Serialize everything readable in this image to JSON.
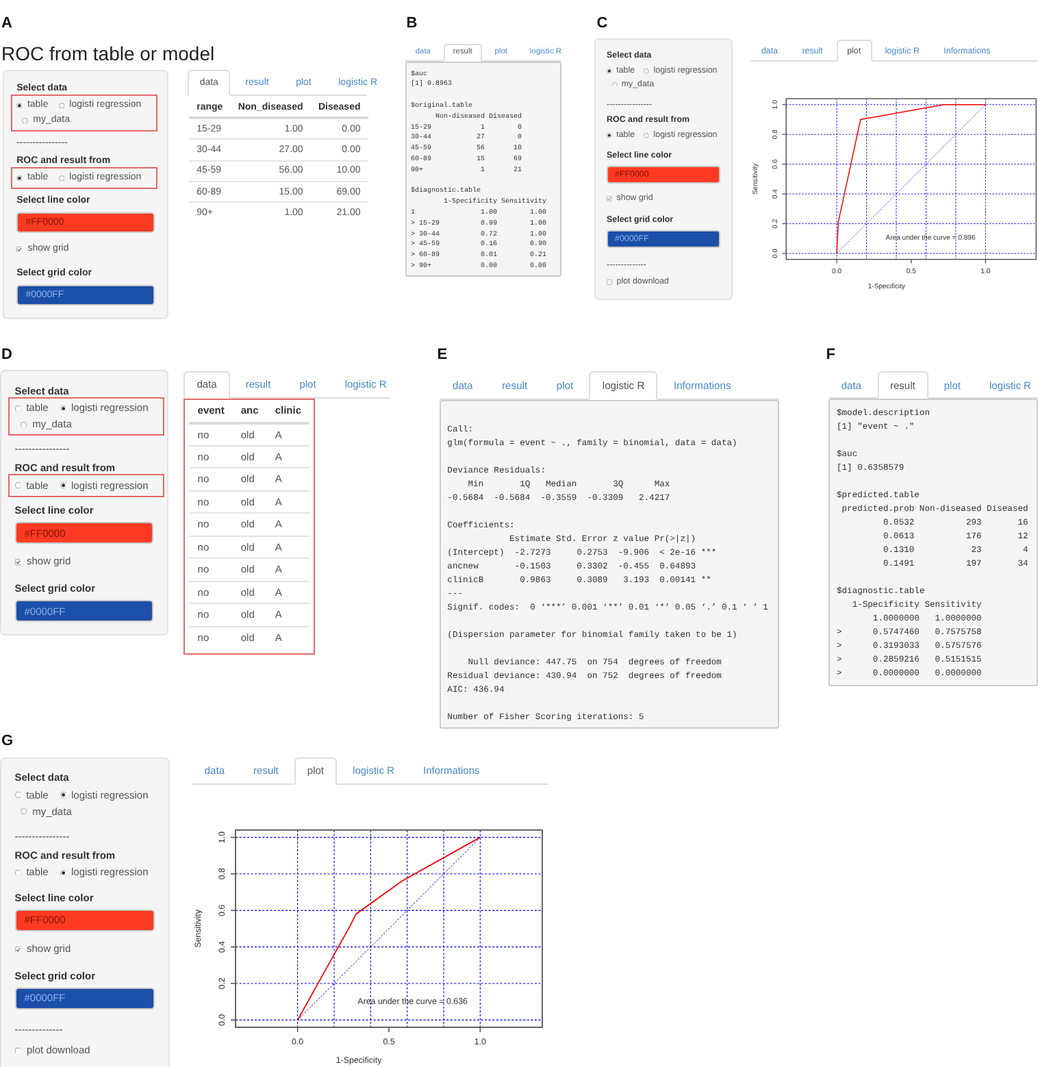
{
  "figure_panels": [
    {
      "letter": "A",
      "title": "ROC from table or model",
      "sidebar": {
        "select_data": {
          "label": "Select data",
          "highlighted": true,
          "options": [
            {
              "label": "table",
              "selected": true
            },
            {
              "label": "logisti regression",
              "selected": false
            },
            {
              "label": "my_data",
              "selected": false
            }
          ]
        },
        "separator": "----------------",
        "roc_source": {
          "label": "ROC and result from",
          "highlighted": true,
          "options": [
            {
              "label": "table",
              "selected": true
            },
            {
              "label": "logisti regression",
              "selected": false
            }
          ]
        },
        "line_color": {
          "label": "Select line color",
          "value": "#FF0000"
        },
        "show_grid": {
          "label": "show grid",
          "checked": true
        },
        "grid_color": {
          "label": "Select grid color",
          "value": "#0000FF"
        }
      },
      "tabs": [
        {
          "label": "data",
          "selected": true
        },
        {
          "label": "result",
          "selected": false
        },
        {
          "label": "plot",
          "selected": false
        },
        {
          "label": "logistic R",
          "selected": false
        }
      ],
      "content": {
        "kind": "table",
        "columns": [
          "range",
          "Non_diseased",
          "Diseased"
        ],
        "rows": [
          [
            "15-29",
            "1.00",
            "0.00"
          ],
          [
            "30-44",
            "27.00",
            "0.00"
          ],
          [
            "45-59",
            "56.00",
            "10.00"
          ],
          [
            "60-89",
            "15.00",
            "69.00"
          ],
          [
            "90+",
            "1.00",
            "21.00"
          ]
        ]
      }
    },
    {
      "letter": "B",
      "tabs": [
        {
          "label": "data",
          "selected": false
        },
        {
          "label": "result",
          "selected": true
        },
        {
          "label": "plot",
          "selected": false
        },
        {
          "label": "logistic R",
          "selected": false
        }
      ],
      "content": {
        "kind": "console",
        "blocks": [
          [
            "$auc",
            "[1] 0.8963"
          ],
          [
            "$original.table",
            "      Non-diseased Diseased",
            "15-29            1        0",
            "30-44           27        0",
            "45-59           56       10",
            "60-89           15       69",
            "90+              1       21"
          ],
          [
            "$diagnostic.table",
            "        1-Specificity Sensitivity",
            "1                1.00        1.00",
            "> 15-29          0.99        1.00",
            "> 30-44          0.72        1.00",
            "> 45-59          0.16        0.90",
            "> 60-89          0.01        0.21",
            "> 90+            0.00        0.00"
          ]
        ]
      }
    },
    {
      "letter": "C",
      "sidebar": {
        "select_data": {
          "label": "Select data",
          "options": [
            {
              "label": "table",
              "selected": true
            },
            {
              "label": "logisti regression",
              "selected": false
            },
            {
              "label": "my_data",
              "selected": false
            }
          ]
        },
        "separator": "----------------",
        "roc_source": {
          "label": "ROC and result from",
          "options": [
            {
              "label": "table",
              "selected": true
            },
            {
              "label": "logisti regression",
              "selected": false
            }
          ]
        },
        "line_color": {
          "label": "Select line color",
          "value": "#FF0000"
        },
        "show_grid": {
          "label": "show grid",
          "checked": true
        },
        "grid_color": {
          "label": "Select grid color",
          "value": "#0000FF"
        },
        "separator_2": "--------------",
        "plot_download": {
          "label": "plot download",
          "checked": false
        }
      },
      "tabs": [
        {
          "label": "data",
          "selected": false
        },
        {
          "label": "result",
          "selected": false
        },
        {
          "label": "plot",
          "selected": true
        },
        {
          "label": "logistic R",
          "selected": false
        },
        {
          "label": "Informations",
          "selected": false
        }
      ],
      "content": {
        "kind": "plot",
        "chart_data": {
          "type": "line",
          "xlabel": "1-Specificity",
          "ylabel": "Sensitivity",
          "x": [
            0,
            0.01,
            0.16,
            0.72,
            0.99,
            1
          ],
          "series": [
            {
              "color": "#ff0000",
              "line_style": "solid",
              "values": [
                0,
                0.21,
                0.9,
                1,
                1,
                1
              ]
            },
            {
              "color": "#0000ff",
              "line_style": "dashed",
              "values": [
                0,
                0.01,
                0.16,
                0.72,
                0.99,
                1
              ]
            }
          ],
          "xlim": [
            -0.34,
            1.34
          ],
          "ylim": [
            -0.04,
            1.04
          ],
          "xticks": [
            {
              "value": 0,
              "label": "0.0"
            },
            {
              "value": 0.5,
              "label": "0.5"
            },
            {
              "value": 1,
              "label": "1.0"
            }
          ],
          "yticks": [
            {
              "value": 0,
              "label": "0.0"
            },
            {
              "value": 0.2,
              "label": "0.2"
            },
            {
              "value": 0.4,
              "label": "0.4"
            },
            {
              "value": 0.6,
              "label": "0.6"
            },
            {
              "value": 0.8,
              "label": "0.8"
            },
            {
              "value": 1,
              "label": "1.0"
            }
          ],
          "grid": true,
          "annotations": [
            "Area under the curve = 0.896"
          ]
        }
      }
    },
    {
      "letter": "D",
      "sidebar": {
        "select_data": {
          "label": "Select data",
          "highlighted": true,
          "options": [
            {
              "label": "table",
              "selected": false
            },
            {
              "label": "logisti regression",
              "selected": true
            },
            {
              "label": "my_data",
              "selected": false
            }
          ]
        },
        "separator": "----------------",
        "roc_source": {
          "label": "ROC and result from",
          "highlighted": true,
          "options": [
            {
              "label": "table",
              "selected": false
            },
            {
              "label": "logisti regression",
              "selected": true
            }
          ]
        },
        "line_color": {
          "label": "Select line color",
          "value": "#FF0000"
        },
        "show_grid": {
          "label": "show grid",
          "checked": true
        },
        "grid_color": {
          "label": "Select grid color",
          "value": "#0000FF"
        }
      },
      "tabs": [
        {
          "label": "data",
          "selected": true
        },
        {
          "label": "result",
          "selected": false
        },
        {
          "label": "plot",
          "selected": false
        },
        {
          "label": "logistic R",
          "selected": false
        }
      ],
      "content": {
        "kind": "table",
        "highlighted": true,
        "columns": [
          "event",
          "anc",
          "clinic"
        ],
        "rows": [
          [
            "no",
            "old",
            "A"
          ],
          [
            "no",
            "old",
            "A"
          ],
          [
            "no",
            "old",
            "A"
          ],
          [
            "no",
            "old",
            "A"
          ],
          [
            "no",
            "old",
            "A"
          ],
          [
            "no",
            "old",
            "A"
          ],
          [
            "no",
            "old",
            "A"
          ],
          [
            "no",
            "old",
            "A"
          ],
          [
            "no",
            "old",
            "A"
          ],
          [
            "no",
            "old",
            "A"
          ]
        ]
      }
    },
    {
      "letter": "E",
      "tabs": [
        {
          "label": "data",
          "selected": false
        },
        {
          "label": "result",
          "selected": false
        },
        {
          "label": "plot",
          "selected": false
        },
        {
          "label": "logistic R",
          "selected": true
        },
        {
          "label": "Informations",
          "selected": false
        }
      ],
      "content": {
        "kind": "console",
        "blocks": [
          [
            "Call:",
            "glm(formula = event ~ ., family = binomial, data = data)"
          ],
          [
            "Deviance Residuals:",
            "    Min       1Q   Median       3Q      Max",
            "-0.5684  -0.5684  -0.3559  -0.3309   2.4217"
          ],
          [
            "Coefficients:",
            "            Estimate Std. Error z value Pr(>|z|)",
            "(Intercept)  -2.7273     0.2753  -9.906  < 2e-16 ***",
            "ancnew       -0.1503     0.3302  -0.455  0.64893",
            "clinicB       0.9863     0.3089   3.193  0.00141 **",
            "---",
            "Signif. codes:  0 ‘***’ 0.001 ‘**’ 0.01 ‘*’ 0.05 ‘.’ 0.1 ‘ ’ 1"
          ],
          [
            "(Dispersion parameter for binomial family taken to be 1)"
          ],
          [
            "    Null deviance: 447.75  on 754  degrees of freedom",
            "Residual deviance: 430.94  on 752  degrees of freedom",
            "AIC: 436.94"
          ],
          [
            "Number of Fisher Scoring iterations: 5"
          ]
        ]
      }
    },
    {
      "letter": "F",
      "tabs": [
        {
          "label": "data",
          "selected": false
        },
        {
          "label": "result",
          "selected": true
        },
        {
          "label": "plot",
          "selected": false
        },
        {
          "label": "logistic R",
          "selected": false
        }
      ],
      "content": {
        "kind": "console",
        "blocks": [
          [
            "$model.description",
            "[1] \"event ~ .\""
          ],
          [
            "$auc",
            "[1] 0.6358579"
          ],
          [
            "$predicted.table",
            " predicted.prob Non-diseased Diseased",
            "         0.0532          293       16",
            "         0.0613          176       12",
            "         0.1310           23        4",
            "         0.1491          197       34"
          ],
          [
            "$diagnostic.table",
            "   1-Specificity Sensitivity",
            "       1.0000000   1.0000000",
            ">      0.5747460   0.7575758",
            ">      0.3193033   0.5757576",
            ">      0.2859216   0.5151515",
            ">      0.0000000   0.0000000"
          ]
        ]
      }
    },
    {
      "letter": "G",
      "sidebar": {
        "select_data": {
          "label": "Select data",
          "options": [
            {
              "label": "table",
              "selected": false
            },
            {
              "label": "logisti regression",
              "selected": true
            },
            {
              "label": "my_data",
              "selected": false
            }
          ]
        },
        "separator": "----------------",
        "roc_source": {
          "label": "ROC and result from",
          "options": [
            {
              "label": "table",
              "selected": false
            },
            {
              "label": "logisti regression",
              "selected": true
            }
          ]
        },
        "line_color": {
          "label": "Select line color",
          "value": "#FF0000"
        },
        "show_grid": {
          "label": "show grid",
          "checked": true
        },
        "grid_color": {
          "label": "Select grid color",
          "value": "#0000FF"
        },
        "separator_2": "--------------",
        "plot_download": {
          "label": "plot download",
          "checked": false
        }
      },
      "tabs": [
        {
          "label": "data",
          "selected": false
        },
        {
          "label": "result",
          "selected": false
        },
        {
          "label": "plot",
          "selected": true
        },
        {
          "label": "logistic R",
          "selected": false
        },
        {
          "label": "Informations",
          "selected": false
        }
      ],
      "content": {
        "kind": "plot",
        "chart_data": {
          "type": "line",
          "xlabel": "1-Specificity",
          "ylabel": "Sensitivity",
          "x": [
            0,
            0.29,
            0.32,
            0.57,
            1
          ],
          "series": [
            {
              "color": "#ff0000",
              "line_style": "solid",
              "values": [
                0,
                0.52,
                0.58,
                0.76,
                1
              ]
            },
            {
              "color": "#0000ff",
              "line_style": "dashed",
              "values": [
                0,
                0.29,
                0.32,
                0.57,
                1
              ]
            }
          ],
          "xlim": [
            -0.34,
            1.34
          ],
          "ylim": [
            -0.04,
            1.04
          ],
          "xticks": [
            {
              "value": 0,
              "label": "0.0"
            },
            {
              "value": 0.5,
              "label": "0.5"
            },
            {
              "value": 1,
              "label": "1.0"
            }
          ],
          "yticks": [
            {
              "value": 0,
              "label": "0.0"
            },
            {
              "value": 0.2,
              "label": "0.2"
            },
            {
              "value": 0.4,
              "label": "0.4"
            },
            {
              "value": 0.6,
              "label": "0.6"
            },
            {
              "value": 0.8,
              "label": "0.8"
            },
            {
              "value": 1,
              "label": "1.0"
            }
          ],
          "grid": true,
          "annotations": [
            "Area under the curve = 0.636"
          ]
        }
      }
    }
  ]
}
